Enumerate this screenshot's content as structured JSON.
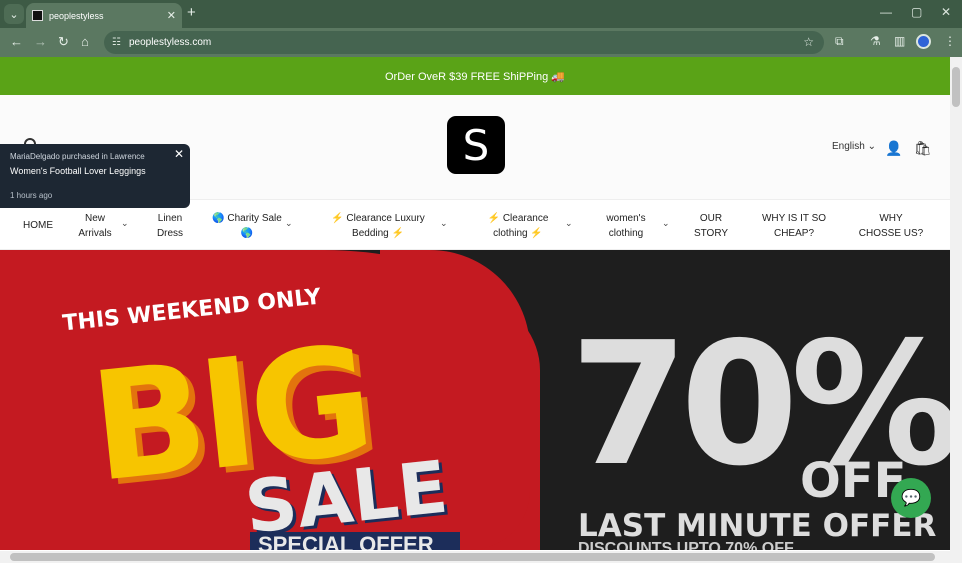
{
  "browser": {
    "tab_title": "peoplestyless",
    "url": "peoplestyless.com",
    "icons": [
      "tab-search-icon",
      "close-icon",
      "new-tab-icon",
      "minimize-icon",
      "maximize-icon",
      "window-close-icon",
      "back-icon",
      "forward-icon",
      "reload-icon",
      "home-icon",
      "site-info-icon",
      "star-icon",
      "extensions-icon",
      "labs-icon",
      "side-panel-icon",
      "profile-icon",
      "menu-icon"
    ]
  },
  "announcement": {
    "text": "OrDer OveR $39 FREE ShiPPing 🚚"
  },
  "header": {
    "logo_letter": "S",
    "language": "English"
  },
  "nav": {
    "items": [
      {
        "label": "HOME"
      },
      {
        "label": "New Arrivals"
      },
      {
        "label": "Linen Dress"
      },
      {
        "label": "🌎 Charity Sale 🌎"
      },
      {
        "label": "⚡ Clearance Luxury Bedding ⚡"
      },
      {
        "label": "⚡ Clearance clothing ⚡"
      },
      {
        "label": "women's clothing"
      },
      {
        "label": "OUR STORY"
      },
      {
        "label": "WHY IS IT SO CHEAP?"
      },
      {
        "label": "WHY CHOSSE US?"
      }
    ]
  },
  "hero": {
    "weekend": "THIS WEEKEND ONLY",
    "big": "BIG",
    "sale": "SALE",
    "special": "SPECIAL OFFER",
    "percent": "70%",
    "off": "OFF",
    "last_minute": "LAST MINUTE OFFER",
    "discounts": "DISCOUNTS UPTO 70% OFF"
  },
  "popup": {
    "line1": "MariaDelgado purchased in Lawrence",
    "product": "Women's Football Lover Leggings",
    "time": "1 hours ago"
  },
  "colors": {
    "announce_bg": "#5aa317",
    "hero_red": "#c41a21",
    "big_yellow": "#f7c500",
    "chat_green": "#33a852"
  }
}
